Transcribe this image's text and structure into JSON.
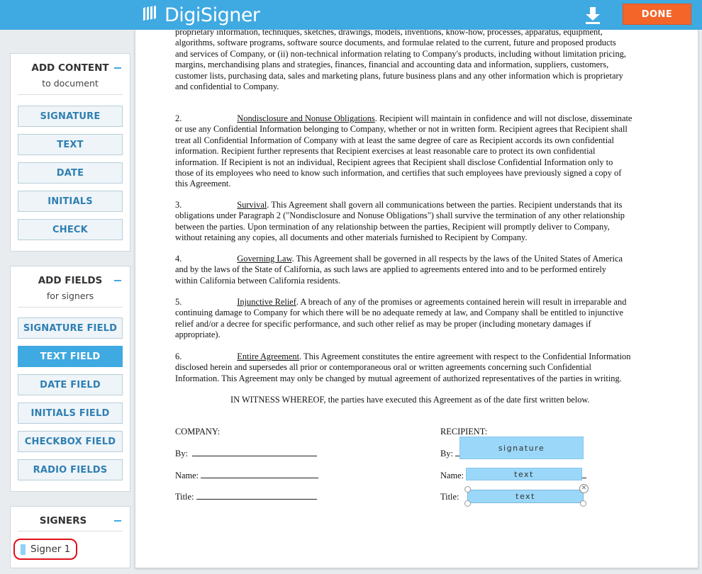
{
  "header": {
    "brand": "DigiSigner",
    "done_label": "DONE",
    "colors": {
      "bar": "#3fa9e1",
      "done": "#f4652a"
    }
  },
  "add_content": {
    "title": "ADD CONTENT",
    "subtitle": "to document",
    "buttons": [
      "SIGNATURE",
      "TEXT",
      "DATE",
      "INITIALS",
      "CHECK"
    ]
  },
  "add_fields": {
    "title": "ADD FIELDS",
    "subtitle": "for signers",
    "buttons": [
      "SIGNATURE FIELD",
      "TEXT FIELD",
      "DATE FIELD",
      "INITIALS FIELD",
      "CHECKBOX FIELD",
      "RADIO FIELDS"
    ],
    "active": "TEXT FIELD"
  },
  "signers": {
    "title": "SIGNERS",
    "items": [
      {
        "label": "Signer 1",
        "color": "#8fd1f7"
      }
    ]
  },
  "document": {
    "intro": [
      "proprietary information, techniques, sketches, drawings, models, inventions, know-how, processes, apparatus, equipment,",
      "algorithms, software programs, software source documents, and formulae related to the current, future and proposed products",
      "and services of Company, or (ii) non-technical information relating to Company's products, including without limitation pricing,",
      "margins, merchandising plans and strategies, finances, financial and accounting data and information, suppliers, customers,",
      "customer lists, purchasing data, sales and marketing plans, future business plans and any other information which is proprietary",
      "and confidential to Company."
    ],
    "s2": {
      "num": "2.",
      "heading": "Nondisclosure and Nonuse Obligations",
      "first": ". Recipient will maintain in confidence and will not disclose, disseminate",
      "rest": [
        "or use any Confidential Information belonging to Company, whether or not in written form.  Recipient agrees that Recipient shall",
        "treat all Confidential Information of Company with at least the same degree of care as Recipient accords its own confidential",
        "information.  Recipient further represents that Recipient exercises at least reasonable care to protect its own confidential",
        "information.  If Recipient is not an individual, Recipient agrees that Recipient shall disclose Confidential Information only to",
        "those of its employees who need to know such information, and certifies that such employees have previously signed a copy of",
        "this Agreement."
      ]
    },
    "s3": {
      "num": "3.",
      "heading": "Survival",
      "first": ".  This Agreement shall govern all communications between the parties.  Recipient understands that its",
      "rest": [
        "obligations under Paragraph 2 (\"Nondisclosure and Nonuse Obligations\") shall survive the termination of any other relationship",
        "between the parties.  Upon termination of any relationship between the parties, Recipient will promptly deliver to Company,",
        "without retaining any copies, all documents and other materials furnished to Recipient by Company."
      ]
    },
    "s4": {
      "num": "4.",
      "heading": "Governing Law",
      "first": ".  This Agreement shall be governed in all respects by the laws of the United States of America",
      "rest": [
        "and by the laws of the State of California, as such laws are applied to agreements entered into and to be performed entirely",
        "within California between California residents."
      ]
    },
    "s5": {
      "num": "5.",
      "heading": "Injunctive Relief",
      "first": ".  A breach of any of the promises or agreements contained herein will result in irreparable and",
      "rest": [
        "continuing damage to Company for which there will be no adequate remedy at law, and Company shall be entitled to injunctive",
        "relief and/or a decree for specific performance, and such other relief as may be proper (including monetary damages if",
        "appropriate)."
      ]
    },
    "s6": {
      "num": "6.",
      "heading": "Entire Agreement",
      "first": ".  This Agreement constitutes the entire agreement with respect to the Confidential Information",
      "rest": [
        "disclosed herein and supersedes all prior or contemporaneous oral or written agreements concerning such Confidential",
        "Information.  This Agreement may only be changed by mutual agreement of authorized representatives of the parties in writing."
      ]
    },
    "witness": "IN WITNESS WHEREOF, the parties have executed this Agreement as of the date first written below.",
    "company": {
      "label": "COMPANY:",
      "by": "By:",
      "name": "Name:",
      "title": "Title:"
    },
    "recipient": {
      "label": "RECIPIENT:",
      "by": "By:",
      "name": "Name:",
      "title": "Title:"
    },
    "fields": {
      "signature": "signature",
      "name_text": "text",
      "title_text": "text"
    }
  }
}
